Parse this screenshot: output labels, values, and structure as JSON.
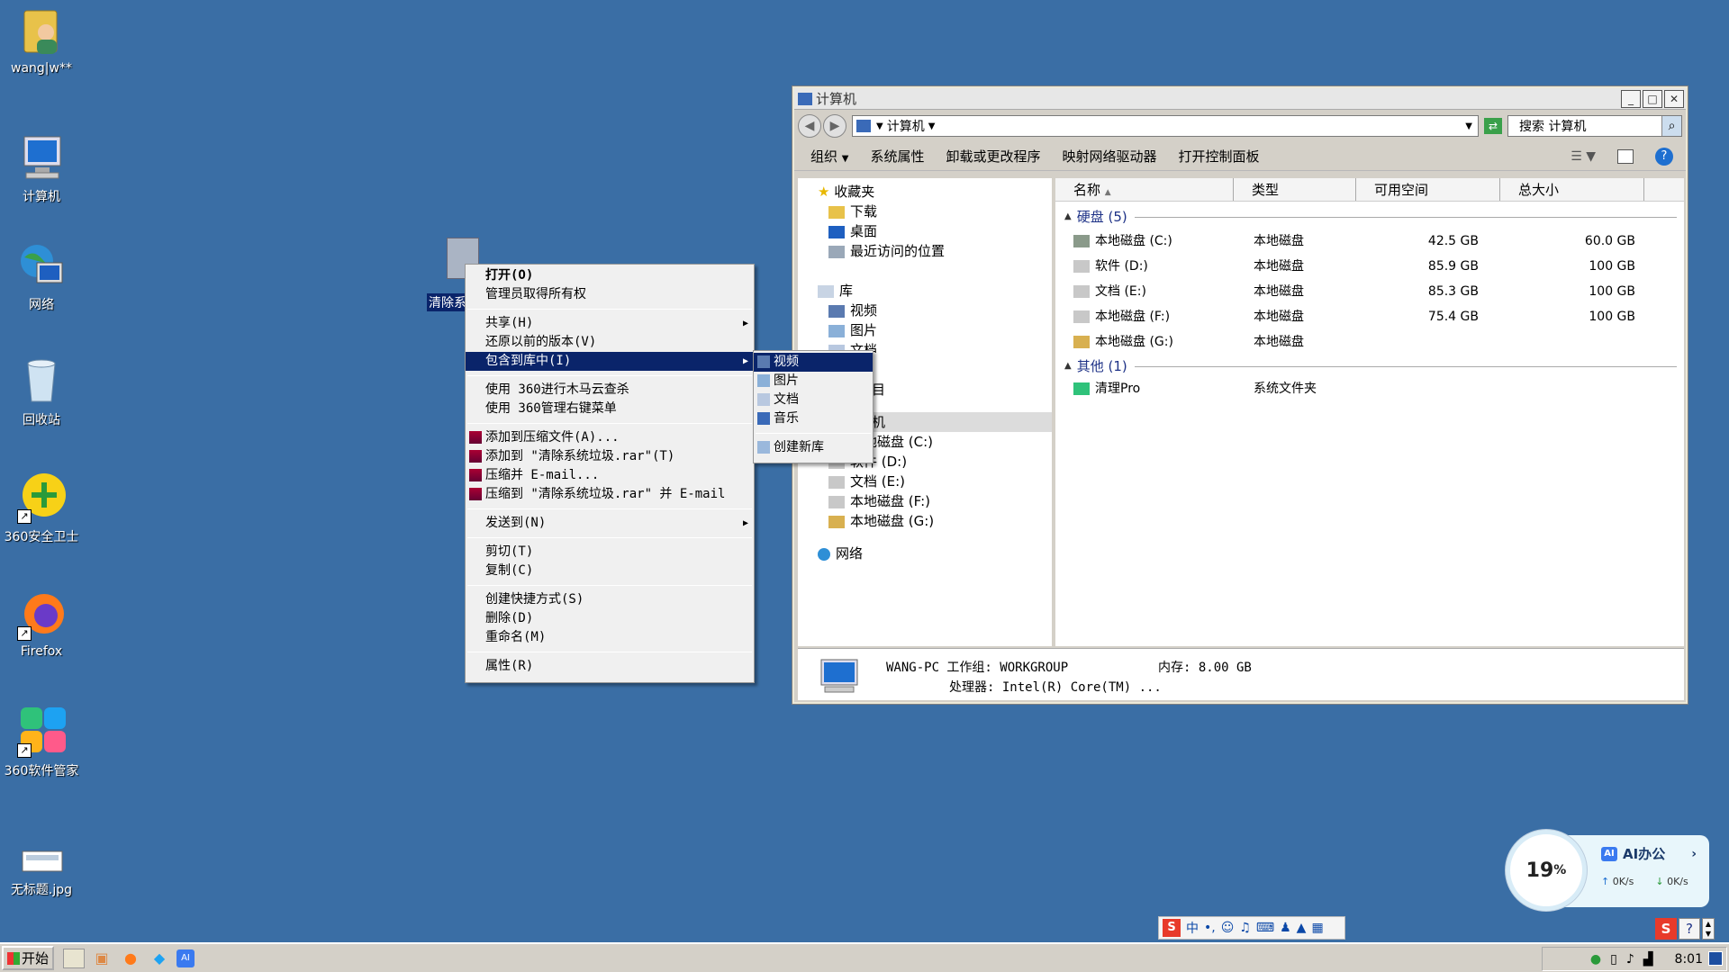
{
  "desktop": {
    "icons": [
      {
        "label": "wang|w**",
        "icon": "user-folder-icon"
      },
      {
        "label": "计算机",
        "icon": "computer-icon"
      },
      {
        "label": "网络",
        "icon": "network-icon"
      },
      {
        "label": "回收站",
        "icon": "recycle-bin-icon"
      },
      {
        "label": "360安全卫士",
        "icon": "360-safe-icon"
      },
      {
        "label": "Firefox",
        "icon": "firefox-icon"
      },
      {
        "label": "360软件管家",
        "icon": "360-software-icon"
      },
      {
        "label": "无标题.jpg",
        "icon": "image-file-icon"
      }
    ],
    "selected_file_label": "清除系"
  },
  "context_menu": {
    "open": "打开(O)",
    "take_ownership": "管理员取得所有权",
    "share": "共享(H)",
    "restore_previous": "还原以前的版本(V)",
    "include_library": "包含到库中(I)",
    "scan_360": "使用 360进行木马云查杀",
    "manage_360": "使用 360管理右键菜单",
    "add_archive": "添加到压缩文件(A)...",
    "add_to_rar": "添加到 \"清除系统垃圾.rar\"(T)",
    "compress_email": "压缩并 E-mail...",
    "compress_rar_email": "压缩到 \"清除系统垃圾.rar\" 并 E-mail",
    "send_to": "发送到(N)",
    "cut": "剪切(T)",
    "copy": "复制(C)",
    "create_shortcut": "创建快捷方式(S)",
    "delete": "删除(D)",
    "rename": "重命名(M)",
    "properties": "属性(R)"
  },
  "submenu": {
    "video": "视频",
    "pictures": "图片",
    "documents": "文档",
    "music": "音乐",
    "new_library": "创建新库"
  },
  "explorer": {
    "title": "计算机",
    "address": "计算机",
    "search_placeholder": "搜索 计算机",
    "toolbar": {
      "organize": "组织",
      "system_properties": "系统属性",
      "uninstall": "卸载或更改程序",
      "map_drive": "映射网络驱动器",
      "control_panel": "打开控制面板"
    },
    "nav": {
      "favorites": "收藏夹",
      "downloads": "下载",
      "desktop": "桌面",
      "recent": "最近访问的位置",
      "libraries": "库",
      "lib_video": "视频",
      "lib_pictures": "图片",
      "lib_docs_partial": "文档",
      "lib_music_partial": "目",
      "computer_partial": "机",
      "drive_c": "本地磁盘 (C:)",
      "drive_d": "软件 (D:)",
      "drive_e": "文档 (E:)",
      "drive_f": "本地磁盘 (F:)",
      "drive_g": "本地磁盘 (G:)",
      "network": "网络"
    },
    "columns": {
      "name": "名称",
      "type": "类型",
      "free": "可用空间",
      "total": "总大小"
    },
    "groups": {
      "disks": "硬盘 (5)",
      "other": "其他 (1)"
    },
    "drives": [
      {
        "name": "本地磁盘 (C:)",
        "type": "本地磁盘",
        "free": "42.5 GB",
        "total": "60.0 GB"
      },
      {
        "name": "软件 (D:)",
        "type": "本地磁盘",
        "free": "85.9 GB",
        "total": "100 GB"
      },
      {
        "name": "文档 (E:)",
        "type": "本地磁盘",
        "free": "85.3 GB",
        "total": "100 GB"
      },
      {
        "name": "本地磁盘 (F:)",
        "type": "本地磁盘",
        "free": "75.4 GB",
        "total": "100 GB"
      },
      {
        "name": "本地磁盘 (G:)",
        "type": "本地磁盘",
        "free": "",
        "total": ""
      }
    ],
    "other": [
      {
        "name": "清理Pro",
        "type": "系统文件夹"
      }
    ],
    "details": {
      "line1": "WANG-PC 工作组: WORKGROUP",
      "memory": "内存: 8.00 GB",
      "line2": "处理器: Intel(R) Core(TM) ..."
    }
  },
  "taskbar": {
    "start": "开始",
    "clock": "8:01"
  },
  "widget": {
    "percent": "19",
    "percent_sign": "%",
    "title": "AI办公",
    "up": "0K/s",
    "down": "0K/s"
  },
  "ime": {
    "mode": "中"
  }
}
